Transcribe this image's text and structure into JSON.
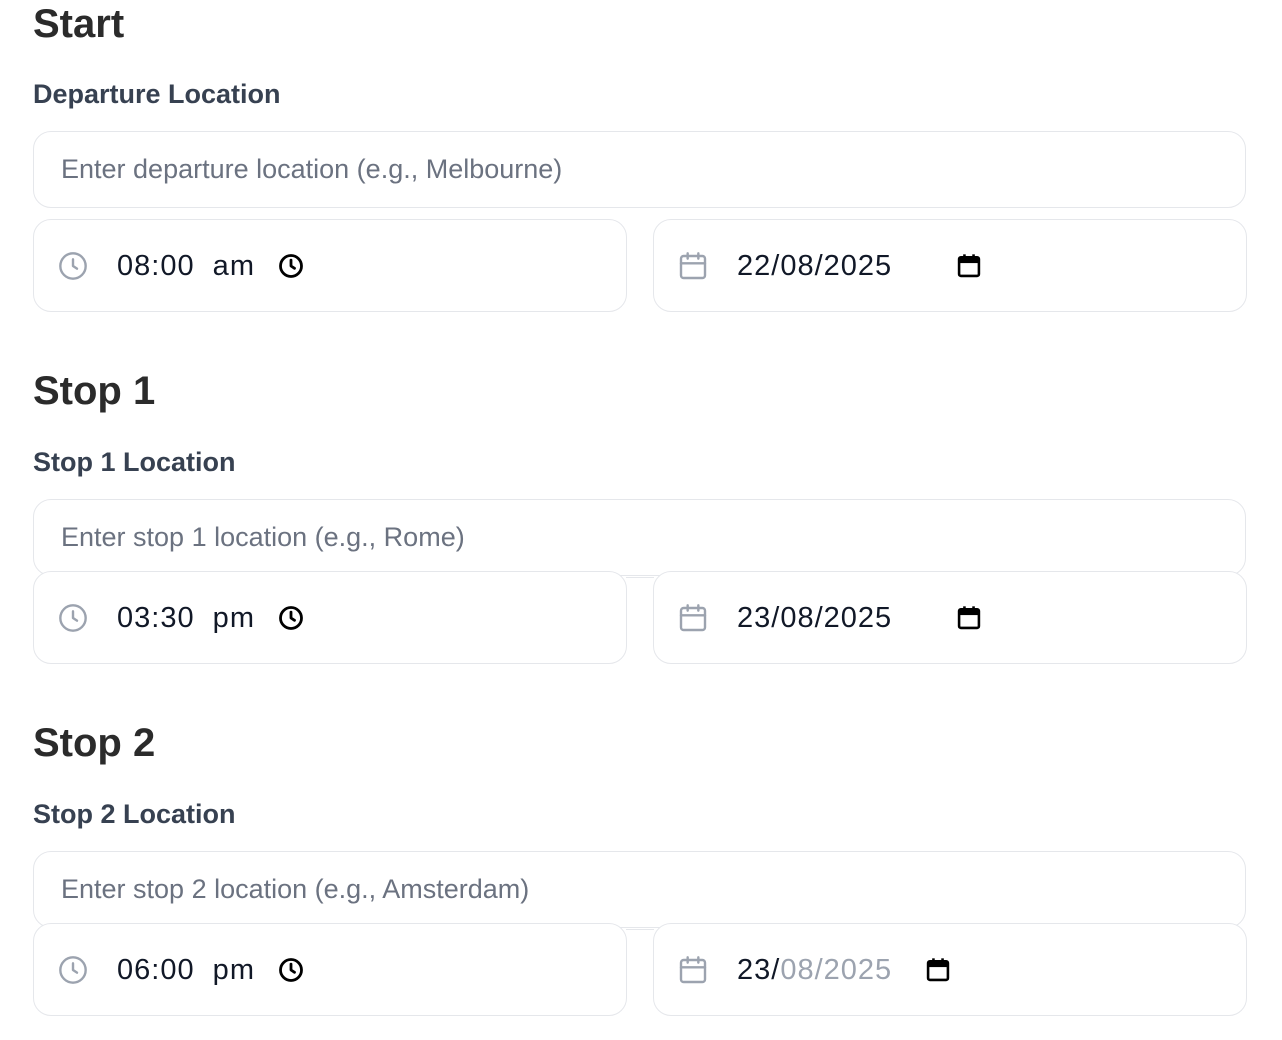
{
  "sections": [
    {
      "title": "Start",
      "location_label": "Departure Location",
      "location_placeholder": "Enter departure location (e.g., Melbourne)",
      "time": "08:00  am",
      "date": "22/08/2025",
      "date_day": "",
      "date_rest": ""
    },
    {
      "title": "Stop 1",
      "location_label": "Stop 1 Location",
      "location_placeholder": "Enter stop 1 location (e.g., Rome)",
      "time": "03:30  pm",
      "date": "23/08/2025",
      "date_day": "",
      "date_rest": ""
    },
    {
      "title": "Stop 2",
      "location_label": "Stop 2 Location",
      "location_placeholder": "Enter stop 2 location (e.g., Amsterdam)",
      "time": "06:00  pm",
      "date": "",
      "date_day": "23/",
      "date_rest": "08/2025"
    }
  ],
  "icons": {
    "lead_time": "clock-icon",
    "picker_time": "clock-icon",
    "lead_date": "calendar-icon",
    "picker_date": "calendar-icon"
  },
  "colors": {
    "border": "#e5e7eb",
    "muted_icon": "#9ca3af",
    "heading": "#2b2b2b",
    "label": "#374151"
  }
}
